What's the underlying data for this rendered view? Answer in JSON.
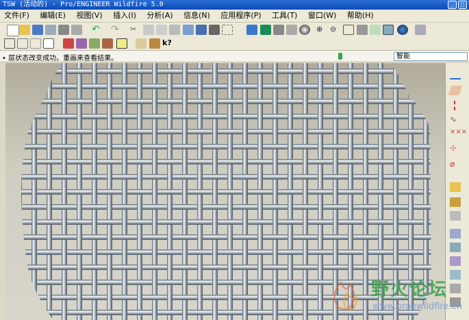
{
  "window": {
    "title": "TSW (活动的) - Pro/ENGINEER Wildfire 5.0"
  },
  "menu": [
    "文件(F)",
    "编辑(E)",
    "视图(V)",
    "插入(I)",
    "分析(A)",
    "信息(N)",
    "应用程序(P)",
    "工具(T)",
    "窗口(W)",
    "帮助(H)"
  ],
  "status": {
    "message": "• 层状态改变成功。重画来查看结果。",
    "filter_value": "智能"
  },
  "watermark": {
    "site_name": "野火论坛",
    "url": "www.proewildfire.cn"
  },
  "colors": {
    "title_bar": "#0b4ab8",
    "background": "#ece9d8",
    "wire": "#9aa4ad"
  }
}
